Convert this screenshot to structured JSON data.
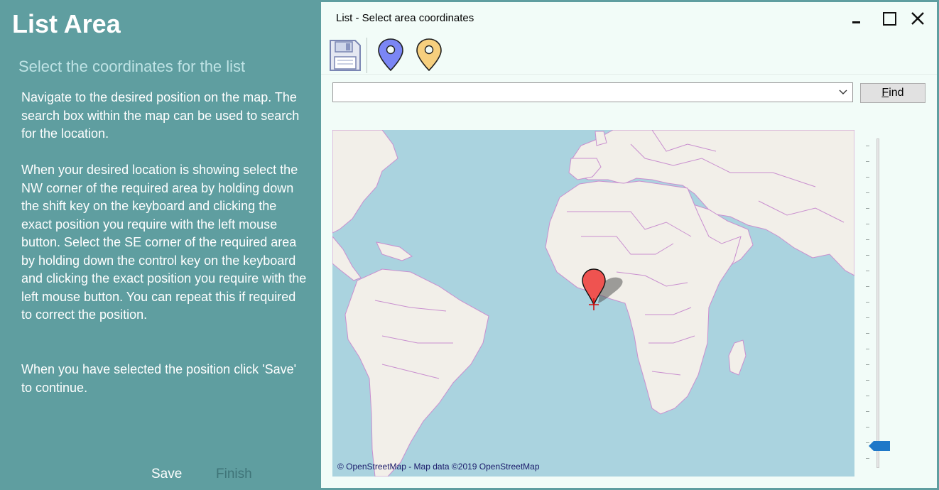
{
  "left_panel": {
    "title": "List Area",
    "subtitle": "Select the coordinates for the list",
    "para1": "Navigate to the desired position on the map. The search box within the map can be used to search for the location.",
    "para2": "When your desired location is showing select the NW corner of the required area by holding down the shift key on the keyboard and clicking the exact position you require with the left mouse button.  Select the SE corner of the required area by holding down the control key on the keyboard and clicking the exact position you require with the left mouse button. You can repeat this if required to correct the position.",
    "para3": "When you have selected the position click 'Save' to continue.",
    "save_label": "Save",
    "finish_label": "Finish"
  },
  "dialog": {
    "title": "List - Select area coordinates",
    "toolbar": {
      "icons": [
        "floppy-disk-icon",
        "blue-map-pin-icon",
        "yellow-map-pin-icon"
      ]
    },
    "search": {
      "value": "",
      "placeholder": ""
    },
    "find_label_prefix": "F",
    "find_label_rest": "ind",
    "map": {
      "attribution": "© OpenStreetMap - Map data ©2019 OpenStreetMap"
    },
    "zoom": {
      "level_fraction": 0.08
    }
  },
  "colors": {
    "panel": "#5f9ea0",
    "subtitle": "#bfe3e5",
    "dialog_bg": "#f2fcf8",
    "water": "#aad3df",
    "land": "#f2efe9",
    "border_lines": "#c98fcf",
    "marker": "#ef5350",
    "slider_thumb": "#1f78c8"
  }
}
